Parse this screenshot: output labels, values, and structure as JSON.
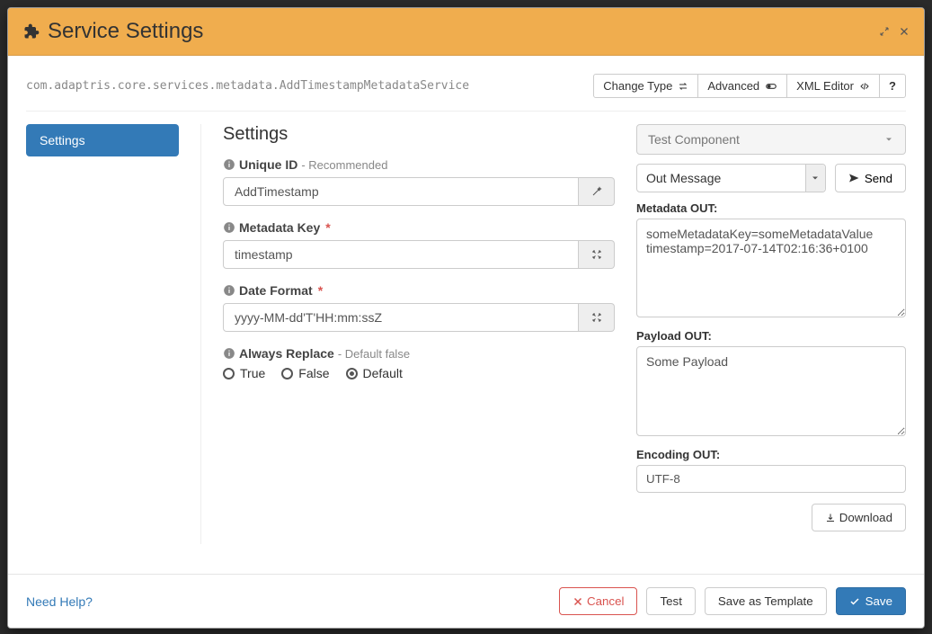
{
  "header": {
    "title": "Service Settings"
  },
  "classname": "com.adaptris.core.services.metadata.AddTimestampMetadataService",
  "toolbar": {
    "change_type": "Change Type",
    "advanced": "Advanced",
    "xml_editor": "XML Editor",
    "help": "?"
  },
  "nav": {
    "items": [
      {
        "label": "Settings",
        "active": true
      }
    ]
  },
  "settings": {
    "heading": "Settings",
    "unique_id": {
      "label": "Unique ID",
      "hint": "- Recommended",
      "value": "AddTimestamp"
    },
    "metadata_key": {
      "label": "Metadata Key",
      "required": true,
      "value": "timestamp"
    },
    "date_format": {
      "label": "Date Format",
      "required": true,
      "value": "yyyy-MM-dd'T'HH:mm:ssZ"
    },
    "always_replace": {
      "label": "Always Replace",
      "hint": "- Default false",
      "options": {
        "true": "True",
        "false": "False",
        "default": "Default"
      },
      "selected": "default"
    }
  },
  "test": {
    "component_select": "Test Component",
    "message_select": "Out Message",
    "send": "Send",
    "metadata_label": "Metadata OUT:",
    "metadata_value": "someMetadataKey=someMetadataValue\ntimestamp=2017-07-14T02:16:36+0100",
    "payload_label": "Payload OUT:",
    "payload_value": "Some Payload",
    "encoding_label": "Encoding OUT:",
    "encoding_value": "UTF-8",
    "download": "Download"
  },
  "footer": {
    "need_help": "Need Help?",
    "cancel": "Cancel",
    "test": "Test",
    "save_template": "Save as Template",
    "save": "Save"
  }
}
